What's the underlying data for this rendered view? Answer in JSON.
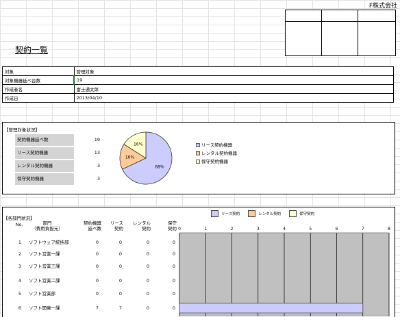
{
  "company": "F株式会社",
  "title": "契約一覧",
  "info": [
    {
      "key": "対象",
      "value": "管理対象"
    },
    {
      "key": "対象機器延べ台数",
      "value": "19"
    },
    {
      "key": "作成者名",
      "value": "富士通太郎"
    },
    {
      "key": "作成日",
      "value": "2013/04/10"
    }
  ],
  "mgmt": {
    "section_label": "【管理対象状況】",
    "stats": [
      {
        "label": "契約機器延べ数",
        "value": "19"
      },
      {
        "label": "リース契約機器",
        "value": "13"
      },
      {
        "label": "レンタル契約機器",
        "value": "3"
      },
      {
        "label": "保守契約機器",
        "value": "3"
      }
    ]
  },
  "pie_legend": [
    "リース契約機器",
    "レンタル契約機器",
    "保守契約機器"
  ],
  "dept": {
    "section_label": "【各部門状況】",
    "headers": {
      "no": "No.",
      "dept": "部門\n（費用負担元）",
      "total": "契約機器\n延べ数",
      "lease": "リース\n契約",
      "rental": "レンタル\n契約",
      "maint": "保守\n契約"
    },
    "rows": [
      {
        "no": "1",
        "name": "ソフトウェア統括部",
        "total": "0",
        "lease": "0",
        "rental": "0",
        "maint": "0"
      },
      {
        "no": "2",
        "name": "ソフト営業一課",
        "total": "0",
        "lease": "0",
        "rental": "0",
        "maint": "0"
      },
      {
        "no": "3",
        "name": "ソフト営業三課",
        "total": "0",
        "lease": "0",
        "rental": "0",
        "maint": "0"
      },
      {
        "no": "4",
        "name": "ソフト営業二課",
        "total": "0",
        "lease": "0",
        "rental": "0",
        "maint": "0"
      },
      {
        "no": "5",
        "name": "ソフト営業部",
        "total": "0",
        "lease": "0",
        "rental": "0",
        "maint": "0"
      },
      {
        "no": "6",
        "name": "ソフト開発一課",
        "total": "7",
        "lease": "7",
        "rental": "0",
        "maint": "0"
      }
    ]
  },
  "bar_legend": [
    "リース契約",
    "レンタル契約",
    "保守契約"
  ],
  "colors": {
    "lease": "#ccccff",
    "rental": "#ffcc99",
    "maint": "#ffffcc",
    "label_bg": "#d4d4d4",
    "plot_bg": "#c0c0c0"
  },
  "chart_data": [
    {
      "type": "pie",
      "categories": [
        "リース契約機器",
        "レンタル契約機器",
        "保守契約機器"
      ],
      "values": [
        68,
        16,
        16
      ],
      "labels": [
        "68%",
        "16%",
        "16%"
      ],
      "legend": "right"
    },
    {
      "type": "bar",
      "orientation": "horizontal",
      "stacked": true,
      "categories": [
        "ソフトウェア統括部",
        "ソフト営業一課",
        "ソフト営業三課",
        "ソフト営業二課",
        "ソフト営業部",
        "ソフト開発一課"
      ],
      "series": [
        {
          "name": "リース契約",
          "values": [
            0,
            0,
            0,
            0,
            0,
            7
          ]
        },
        {
          "name": "レンタル契約",
          "values": [
            0,
            0,
            0,
            0,
            0,
            0
          ]
        },
        {
          "name": "保守契約",
          "values": [
            0,
            0,
            0,
            0,
            0,
            0
          ]
        }
      ],
      "xlim": [
        0,
        8
      ],
      "xticks": [
        "0",
        "1",
        "2",
        "3",
        "4",
        "5",
        "6",
        "7",
        "8"
      ],
      "grid": true,
      "legend": "top"
    }
  ]
}
